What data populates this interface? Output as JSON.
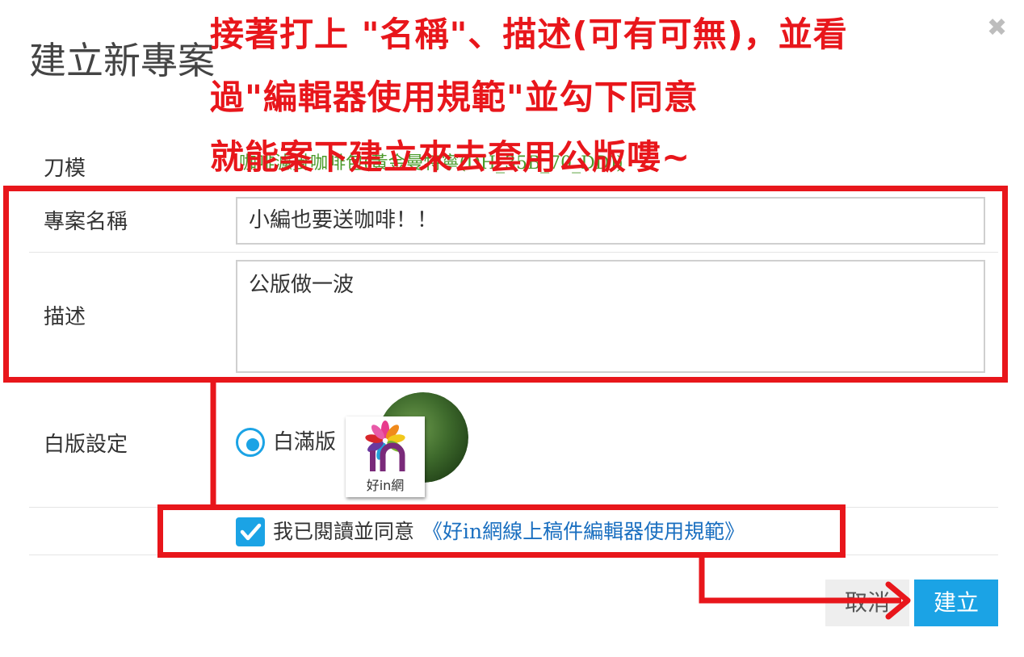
{
  "dialog": {
    "title": "建立新專案",
    "close_icon": "close-icon"
  },
  "form": {
    "die_label": "刀模",
    "die_value": "咖啡濾掛咖啡包(黃金曼特寧(DH_35B_70_DD))",
    "name_label": "專案名稱",
    "name_value": "小編也要送咖啡！！",
    "desc_label": "描述",
    "desc_value": "公版做一波",
    "white_label": "白版設定",
    "white_option": "白滿版",
    "logo_text": "好in網",
    "agree_text": "我已閱讀並同意",
    "agree_link": "《好in網線上稿件編輯器使用規範》",
    "agree_checked": true
  },
  "buttons": {
    "cancel": "取消",
    "create": "建立"
  },
  "annotation": {
    "line1": "接著打上 \"名稱\"、描述(可有可無)，並看",
    "line2": "過\"編輯器使用規範\"並勾下同意",
    "line3": "就能案下建立來去套用公版嘍~",
    "color": "#e8161b"
  },
  "colors": {
    "accent": "#1ba3e5",
    "annotation": "#e8161b",
    "link": "#1a6fc0"
  }
}
